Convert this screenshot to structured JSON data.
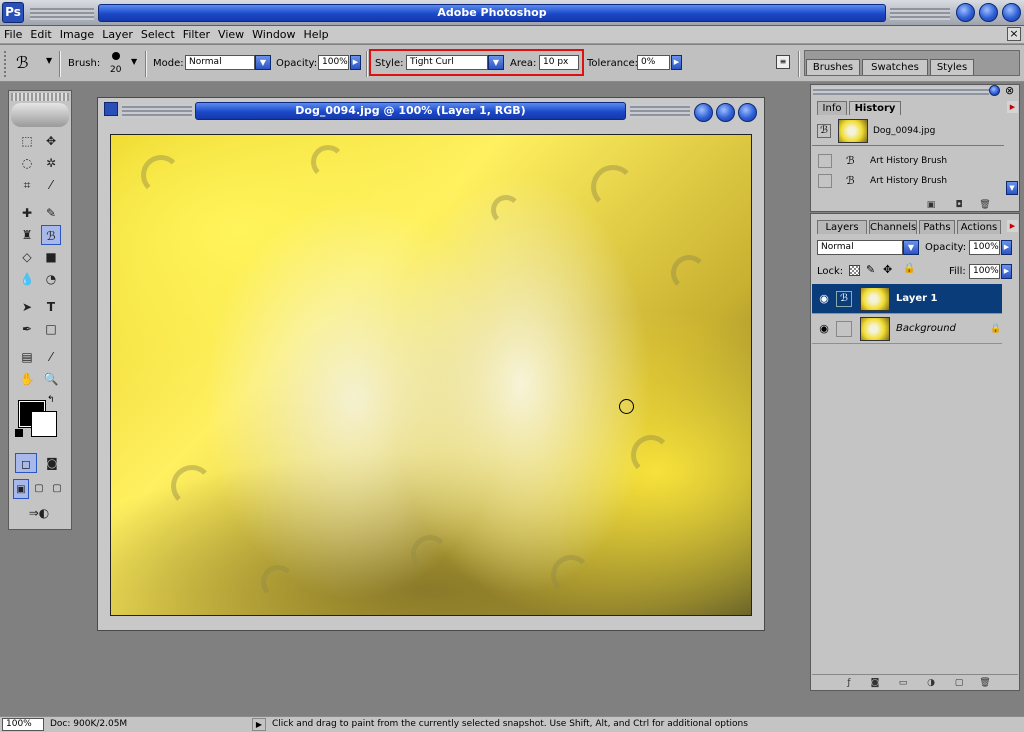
{
  "app": {
    "title": "Adobe Photoshop"
  },
  "menu": [
    "File",
    "Edit",
    "Image",
    "Layer",
    "Select",
    "Filter",
    "View",
    "Window",
    "Help"
  ],
  "options": {
    "brush_label": "Brush:",
    "brush_size": "20",
    "mode_label": "Mode:",
    "mode_value": "Normal",
    "opacity_label": "Opacity:",
    "opacity_value": "100%",
    "style_label": "Style:",
    "style_value": "Tight Curl",
    "area_label": "Area:",
    "area_value": "10 px",
    "tolerance_label": "Tolerance:",
    "tolerance_value": "0%"
  },
  "palette_well": [
    "Brushes",
    "Swatches",
    "Styles"
  ],
  "document": {
    "title": "Dog_0094.jpg @ 100% (Layer 1, RGB)"
  },
  "history_panel": {
    "tabs": [
      "Info",
      "History"
    ],
    "snapshot": "Dog_0094.jpg",
    "items": [
      "Art History Brush",
      "Art History Brush"
    ]
  },
  "layers_panel": {
    "tabs": [
      "Layers",
      "Channels",
      "Paths",
      "Actions"
    ],
    "blend_mode": "Normal",
    "opacity_label": "Opacity:",
    "opacity_value": "100%",
    "lock_label": "Lock:",
    "fill_label": "Fill:",
    "fill_value": "100%",
    "layers": [
      "Layer 1",
      "Background"
    ]
  },
  "status": {
    "zoom": "100%",
    "doc": "Doc: 900K/2.05M",
    "hint": "Click and drag to paint from the currently selected snapshot. Use Shift, Alt, and Ctrl for additional options"
  },
  "colors": {
    "title_blue": "#1c49c9",
    "selection": "#0a3c7a",
    "highlight": "#e01010"
  }
}
